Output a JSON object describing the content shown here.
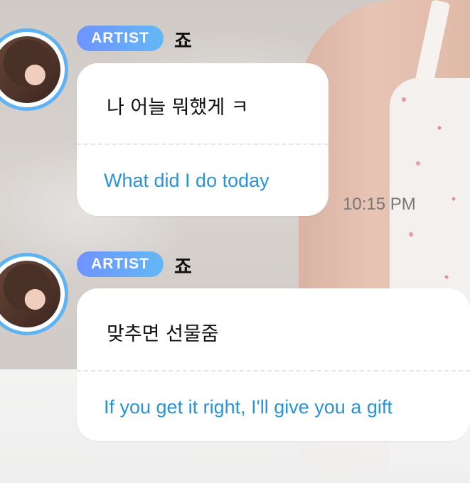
{
  "messages": [
    {
      "badge": "ARTIST",
      "name": "죠",
      "original": "나 어늘 뭐했게 ㅋ",
      "translation": "What did I do today",
      "time": "10:15 PM"
    },
    {
      "badge": "ARTIST",
      "name": "죠",
      "original": "맞추면 선물줌",
      "translation": "If you get it right, I'll give you a gift"
    }
  ],
  "colors": {
    "badge_gradient_start": "#6e93ff",
    "badge_gradient_end": "#64b8f5",
    "avatar_ring": "#5fb3f3",
    "translation_text": "#2a93d5",
    "timestamp_text": "#777777"
  },
  "icons": [
    "avatar"
  ]
}
